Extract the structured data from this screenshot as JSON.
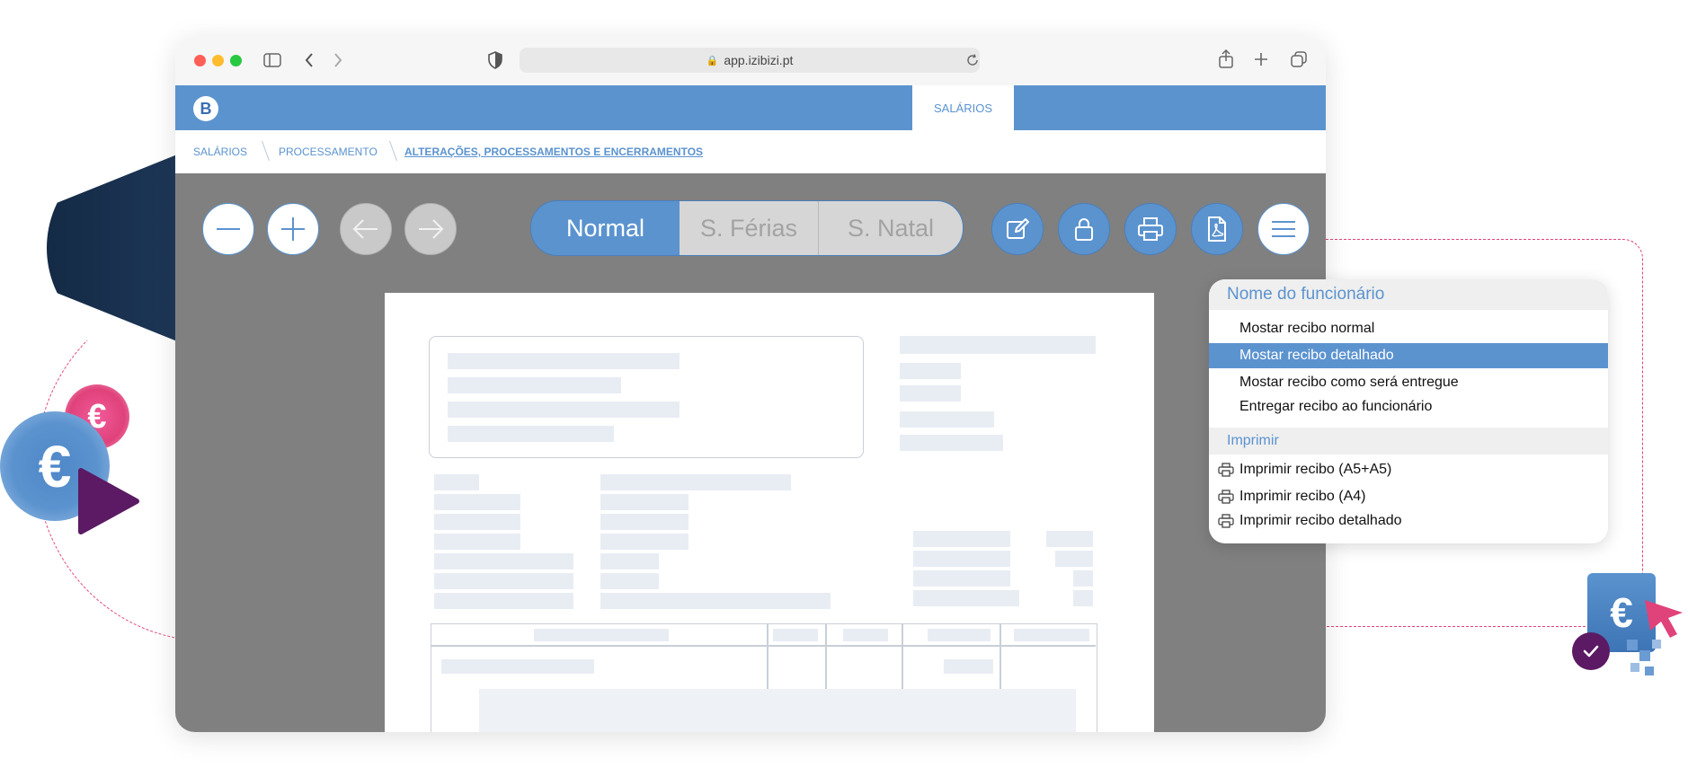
{
  "browser": {
    "url": "app.izibizi.pt"
  },
  "app": {
    "logo_letter": "B",
    "active_tab": "SALÁRIOS"
  },
  "breadcrumb": {
    "items": [
      "SALÁRIOS",
      "PROCESSAMENTO",
      "ALTERAÇÕES, PROCESSAMENTOS E ENCERRAMENTOS"
    ]
  },
  "toolbar": {
    "segments": [
      "Normal",
      "S. Férias",
      "S. Natal"
    ],
    "selected_segment": "Normal"
  },
  "menu": {
    "header": "Nome do funcionário",
    "items": [
      "Mostar recibo normal",
      "Mostar recibo detalhado",
      "Mostar recibo como será entregue",
      "Entregar recibo ao funcionário"
    ],
    "selected_item": "Mostar recibo detalhado",
    "print_header": "Imprimir",
    "print_items": [
      "Imprimir recibo (A5+A5)",
      "Imprimir recibo (A4)",
      "Imprimir recibo detalhado"
    ]
  },
  "colors": {
    "brand_blue": "#5b93cf",
    "navy": "#1d3656",
    "pink": "#e0427a",
    "purple": "#5b1a63",
    "gray_bg": "#808080"
  },
  "icons": {
    "euro_symbol": "€"
  }
}
